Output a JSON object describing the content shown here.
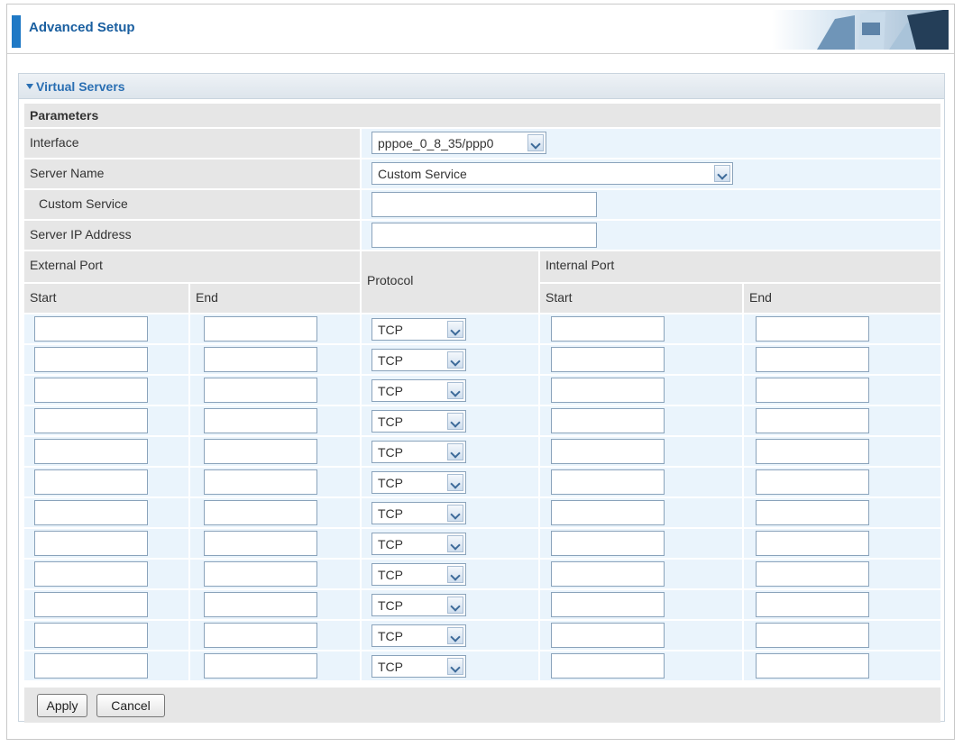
{
  "header": {
    "title": "Advanced Setup"
  },
  "section": {
    "title": "Virtual Servers"
  },
  "parameters": {
    "heading": "Parameters",
    "interface": {
      "label": "Interface",
      "value": "pppoe_0_8_35/ppp0"
    },
    "server_name": {
      "label": "Server Name",
      "value": "Custom Service"
    },
    "custom_service": {
      "label": "Custom Service",
      "value": ""
    },
    "server_ip": {
      "label": "Server IP Address",
      "value": ""
    }
  },
  "ports": {
    "external_port": "External Port",
    "internal_port": "Internal Port",
    "protocol": "Protocol",
    "start": "Start",
    "end": "End",
    "rows": [
      {
        "protocol": "TCP"
      },
      {
        "protocol": "TCP"
      },
      {
        "protocol": "TCP"
      },
      {
        "protocol": "TCP"
      },
      {
        "protocol": "TCP"
      },
      {
        "protocol": "TCP"
      },
      {
        "protocol": "TCP"
      },
      {
        "protocol": "TCP"
      },
      {
        "protocol": "TCP"
      },
      {
        "protocol": "TCP"
      },
      {
        "protocol": "TCP"
      },
      {
        "protocol": "TCP"
      }
    ]
  },
  "buttons": {
    "apply": "Apply",
    "cancel": "Cancel"
  }
}
